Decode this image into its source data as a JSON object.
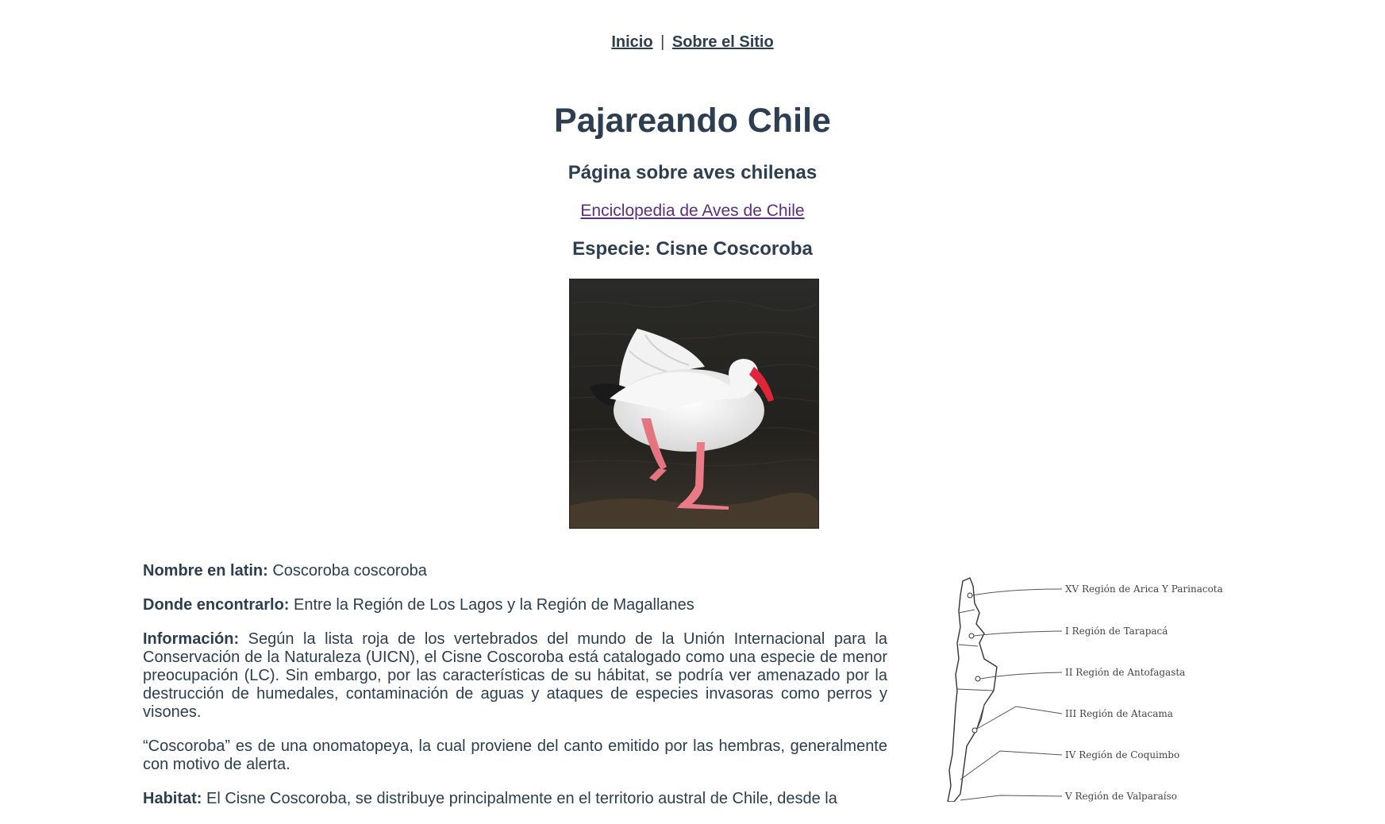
{
  "nav": {
    "home_label": "Inicio",
    "separator": "|",
    "about_label": "Sobre el Sitio"
  },
  "header": {
    "title": "Pajareando Chile",
    "subtitle": "Página sobre aves chilenas",
    "encyclopedia_link": "Enciclopedia de Aves de Chile",
    "species_heading": "Especie: Cisne Coscoroba"
  },
  "species": {
    "latin_label": "Nombre en latin:",
    "latin_value": "Coscoroba coscoroba",
    "where_label": "Donde encontrarlo:",
    "where_value": "Entre la Región de Los Lagos y la Región de Magallanes",
    "info_label": "Información:",
    "info_value": "Según la lista roja de los vertebrados del mundo de la Unión Internacional para la Conservación de la Naturaleza (UICN), el Cisne Coscoroba está catalogado como una especie de menor preocupación (LC). Sin embargo, por las características de su hábitat, se podría ver amenazado por la destrucción de humedales, contaminación de aguas y ataques de especies invasoras como perros y visones.",
    "etymology": "“Coscoroba” es de una onomatopeya, la cual proviene del canto emitido por las hembras, generalmente con motivo de alerta.",
    "habitat_label": "Habitat:",
    "habitat_value": "El Cisne Coscoroba, se distribuye principalmente en el territorio austral de Chile, desde la"
  },
  "map": {
    "regions": [
      "XV Región de Arica Y Parinacota",
      "I Región de Tarapacá",
      "II Región de Antofagasta",
      "III Región de Atacama",
      "IV Región de Coquimbo",
      "V Región de Valparaíso"
    ]
  },
  "colors": {
    "text": "#2c3e50",
    "visited_link": "#5b2e7e",
    "background": "#ffffff"
  }
}
